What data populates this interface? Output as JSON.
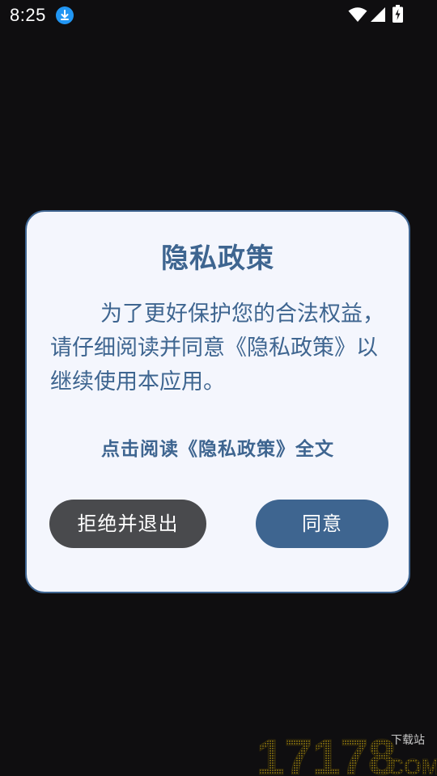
{
  "status_bar": {
    "time": "8:25",
    "icons": [
      "download-icon",
      "wifi-icon",
      "signal-icon",
      "battery-charging-icon"
    ]
  },
  "dialog": {
    "title": "隐私政策",
    "body": "为了更好保护您的合法权益，请仔细阅读并同意《隐私政策》以继续使用本应用。",
    "policy_link": "点击阅读《隐私政策》全文",
    "refuse_button": "拒绝并退出",
    "agree_button": "同意"
  },
  "watermark": {
    "number": "17178",
    "site_suffix": ".COM",
    "tag": "下载站"
  },
  "colors": {
    "background": "#0f0e10",
    "dialog_background": "#f4f6fd",
    "accent": "#3e6590",
    "refuse_button": "#494a4d",
    "download_badge": "#2196f3"
  }
}
